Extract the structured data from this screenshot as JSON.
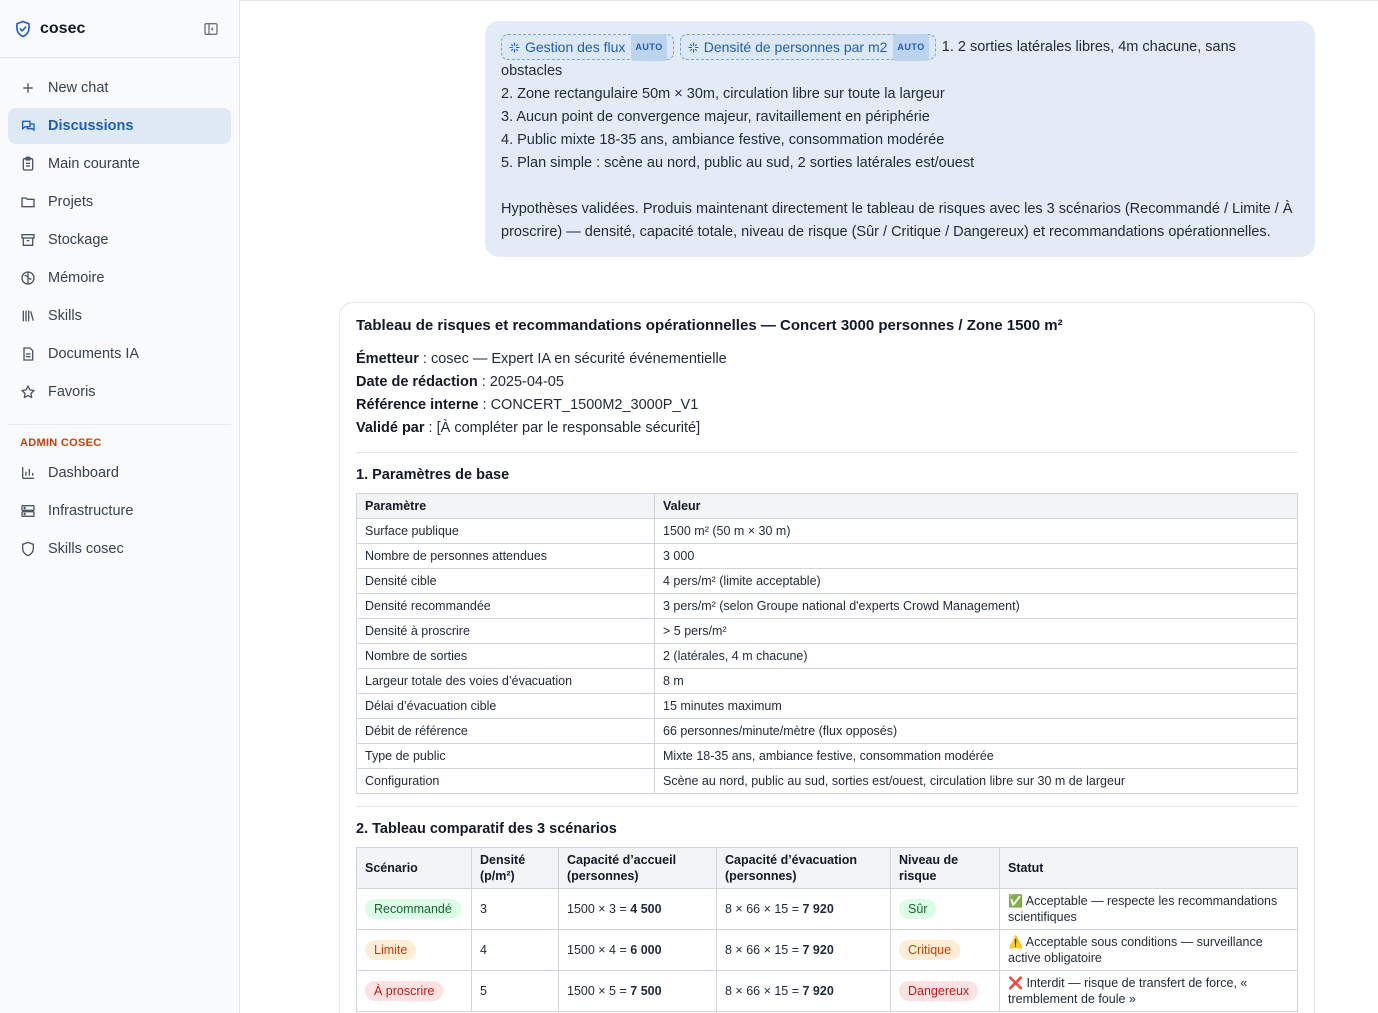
{
  "sidebar": {
    "brand": "cosec",
    "items": [
      {
        "label": "New chat",
        "icon": "plus-icon"
      },
      {
        "label": "Discussions",
        "icon": "chat-icon"
      },
      {
        "label": "Main courante",
        "icon": "clipboard-icon"
      },
      {
        "label": "Projets",
        "icon": "folder-icon"
      },
      {
        "label": "Stockage",
        "icon": "archive-icon"
      },
      {
        "label": "Mémoire",
        "icon": "brain-icon"
      },
      {
        "label": "Skills",
        "icon": "library-icon"
      },
      {
        "label": "Documents IA",
        "icon": "document-icon"
      },
      {
        "label": "Favoris",
        "icon": "star-icon"
      }
    ],
    "admin_title": "ADMIN COSEC",
    "admin_items": [
      {
        "label": "Dashboard",
        "icon": "bar-chart-icon"
      },
      {
        "label": "Infrastructure",
        "icon": "server-icon"
      },
      {
        "label": "Skills cosec",
        "icon": "shield-icon"
      }
    ]
  },
  "user_message": {
    "chips": [
      {
        "label": "Gestion des flux",
        "tag": "AUTO"
      },
      {
        "label": "Densité de personnes par m2",
        "tag": "AUTO"
      }
    ],
    "line1": "1. 2 sorties latérales libres, 4m chacune, sans obstacles",
    "line2": "2. Zone rectangulaire 50m × 30m, circulation libre sur toute la largeur",
    "line3": "3. Aucun point de convergence majeur, ravitaillement en périphérie",
    "line4": "4. Public mixte 18-35 ans, ambiance festive, consommation modérée",
    "line5": "5. Plan simple : scène au nord, public au sud, 2 sorties latérales est/ouest",
    "paragraph": "Hypothèses validées. Produis maintenant directement le tableau de risques avec les 3 scénarios (Recommandé / Limite / À proscrire) — densité, capacité totale, niveau de risque (Sûr / Critique / Dangereux) et recommandations opérationnelles."
  },
  "response": {
    "title": "Tableau de risques et recommandations opérationnelles — Concert 3000 personnes / Zone 1500 m²",
    "meta": {
      "emetteur_label": "Émetteur",
      "emetteur_value": " : cosec — Expert IA en sécurité événementielle",
      "date_label": "Date de rédaction",
      "date_value": " : 2025-04-05",
      "ref_label": "Référence interne",
      "ref_value": " : CONCERT_1500M2_3000P_V1",
      "valide_label": "Validé par",
      "valide_value": " : [À compléter par le responsable sécurité]"
    },
    "section1_title": "1. Paramètres de base",
    "params_headers": [
      "Paramètre",
      "Valeur"
    ],
    "params": [
      [
        "Surface publique",
        "1500 m² (50 m × 30 m)"
      ],
      [
        "Nombre de personnes attendues",
        "3 000"
      ],
      [
        "Densité cible",
        "4 pers/m² (limite acceptable)"
      ],
      [
        "Densité recommandée",
        "3 pers/m² (selon Groupe national d'experts Crowd Management)"
      ],
      [
        "Densité à proscrire",
        "> 5 pers/m²"
      ],
      [
        "Nombre de sorties",
        "2 (latérales, 4 m chacune)"
      ],
      [
        "Largeur totale des voies d’évacuation",
        "8 m"
      ],
      [
        "Délai d’évacuation cible",
        "15 minutes maximum"
      ],
      [
        "Débit de référence",
        "66 personnes/minute/mètre (flux opposés)"
      ],
      [
        "Type de public",
        "Mixte 18-35 ans, ambiance festive, consommation modérée"
      ],
      [
        "Configuration",
        "Scène au nord, public au sud, sorties est/ouest, circulation libre sur 30 m de largeur"
      ]
    ],
    "section2_title": "2. Tableau comparatif des 3 scénarios",
    "scen_headers": {
      "scenario": "Scénario",
      "densite_1": "Densité",
      "densite_2": "(p/m²)",
      "accueil_1": "Capacité d’accueil",
      "accueil_2": "(personnes)",
      "evac_1": "Capacité d’évacuation",
      "evac_2": "(personnes)",
      "risque_1": "Niveau de",
      "risque_2": "risque",
      "statut": "Statut"
    },
    "scenarios": [
      {
        "name": "Recommandé",
        "density": "3",
        "accueil_formula": "1500 × 3 = ",
        "accueil_total": "4 500",
        "evac_formula": "8 × 66 × 15 = ",
        "evac_total": "7 920",
        "risk": "Sûr",
        "status_emoji": "✅",
        "status_line1": "Acceptable — respecte les recommandations",
        "status_line2": "scientifiques",
        "color": "#166534"
      },
      {
        "name": "Limite",
        "density": "4",
        "accueil_formula": "1500 × 4 = ",
        "accueil_total": "6 000",
        "evac_formula": "8 × 66 × 15 = ",
        "evac_total": "7 920",
        "risk": "Critique",
        "status_emoji": "⚠️",
        "status_line1": "Acceptable sous conditions — surveillance",
        "status_line2": "active obligatoire",
        "color": "#c2410c"
      },
      {
        "name": "À proscrire",
        "density": "5",
        "accueil_formula": "1500 × 5 = ",
        "accueil_total": "7 500",
        "evac_formula": "8 × 66 × 15 = ",
        "evac_total": "7 920",
        "risk": "Dangereux",
        "status_emoji": "❌",
        "status_line1": "Interdit — risque de transfert de force, «",
        "status_line2": "tremblement de foule »",
        "color": "#b91c1c"
      }
    ]
  }
}
